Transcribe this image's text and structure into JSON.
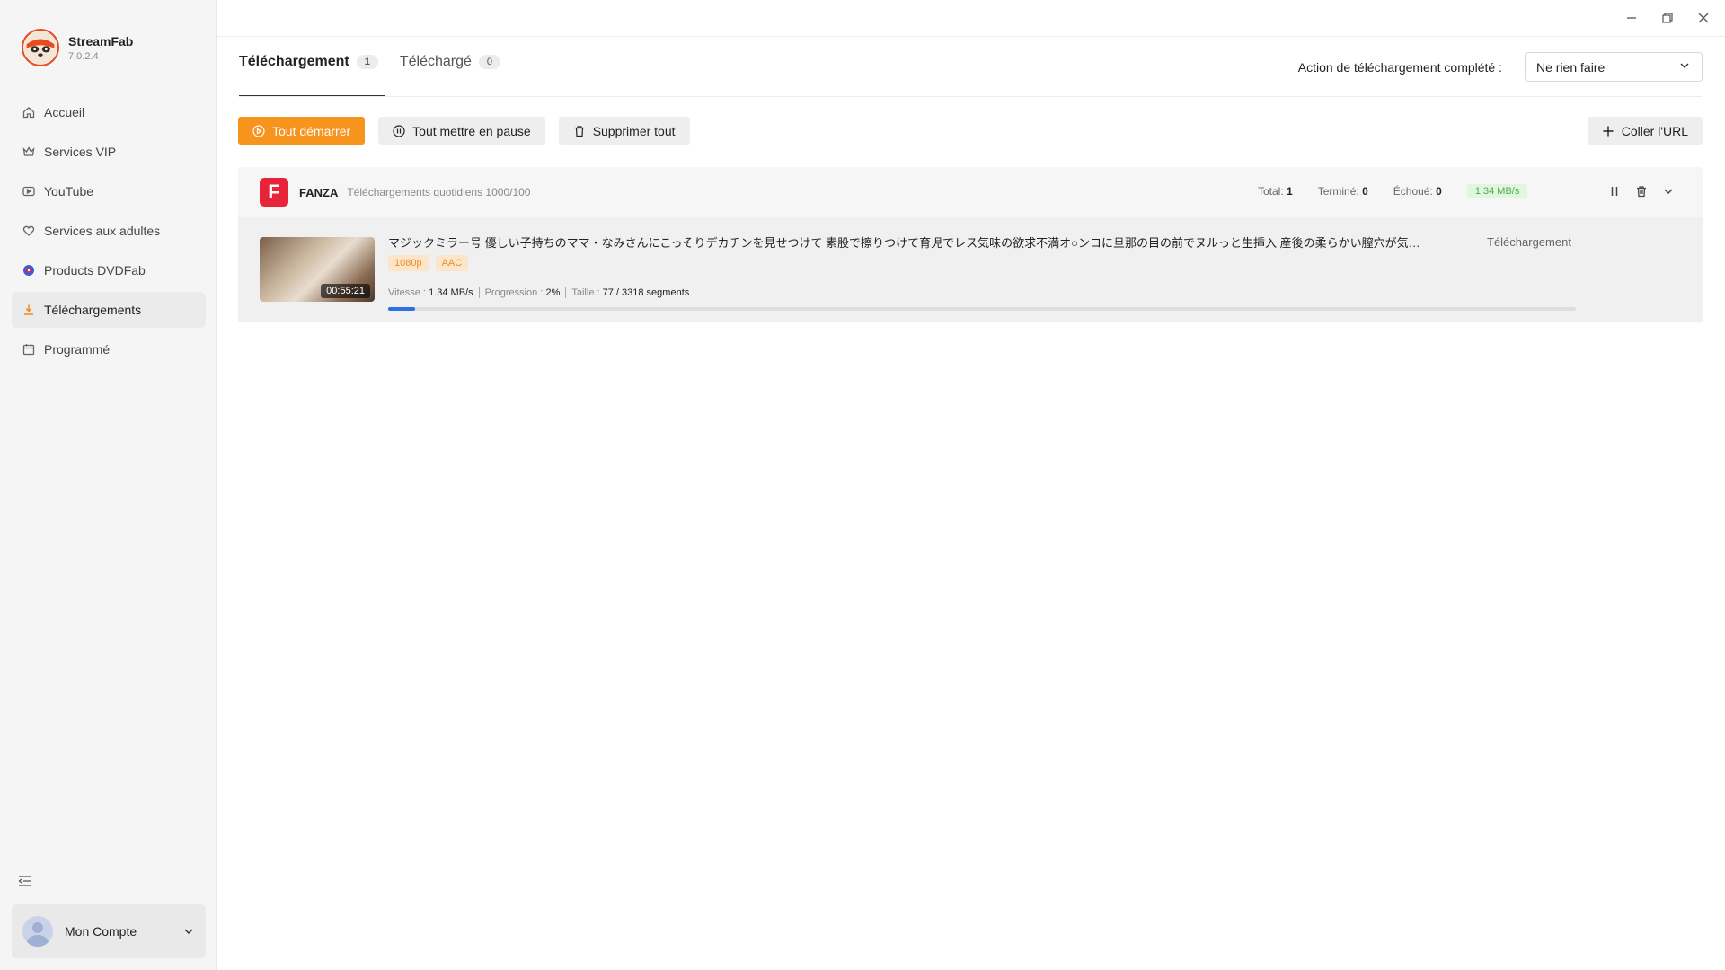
{
  "app": {
    "name": "StreamFab",
    "version": "7.0.2.4"
  },
  "sidebar": {
    "items": [
      {
        "label": "Accueil",
        "icon": "home-icon",
        "active": false
      },
      {
        "label": "Services VIP",
        "icon": "crown-icon",
        "active": false
      },
      {
        "label": "YouTube",
        "icon": "play-icon",
        "active": false
      },
      {
        "label": "Services aux adultes",
        "icon": "heart-icon",
        "active": false
      },
      {
        "label": "Products DVDFab",
        "icon": "dvdfab-icon",
        "active": false
      },
      {
        "label": "Téléchargements",
        "icon": "download-icon",
        "active": true
      },
      {
        "label": "Programmé",
        "icon": "calendar-icon",
        "active": false
      }
    ],
    "account_label": "Mon Compte"
  },
  "tabs": [
    {
      "label": "Téléchargement",
      "count": "1",
      "active": true
    },
    {
      "label": "Téléchargé",
      "count": "0",
      "active": false
    }
  ],
  "completion": {
    "label": "Action de téléchargement complété :",
    "value": "Ne rien faire"
  },
  "toolbar": {
    "start_all": "Tout démarrer",
    "pause_all": "Tout mettre en pause",
    "delete_all": "Supprimer tout",
    "paste_url": "Coller l'URL"
  },
  "group": {
    "logo_letter": "F",
    "name": "FANZA",
    "quota": "Téléchargements quotidiens 1000/100",
    "total_label": "Total:",
    "total": "1",
    "done_label": "Terminé:",
    "done": "0",
    "failed_label": "Échoué:",
    "failed": "0",
    "speed": "1.34 MB/s"
  },
  "item": {
    "title": "マジックミラー号 優しい子持ちのママ・なみさんにこっそりデカチンを見せつけて 素股で擦りつけて育児でレス気味の欲求不満オ○ンコに旦那の目の前でヌルっと生挿入 産後の柔らかい膣穴が気持ち良すぎて中出し…",
    "duration": "00:55:21",
    "tags": [
      "1080p",
      "AAC"
    ],
    "status": "Téléchargement",
    "speed_label": "Vitesse :",
    "speed": "1.34 MB/s",
    "progress_label": "Progression :",
    "progress": "2%",
    "progress_value": 0.023,
    "size_label": "Taille :",
    "size": "77 / 3318 segments"
  },
  "colors": {
    "accent": "#f7941e",
    "progress": "#2f6fe4",
    "brand_red": "#e8243a",
    "speed_green": "#49b04a"
  }
}
